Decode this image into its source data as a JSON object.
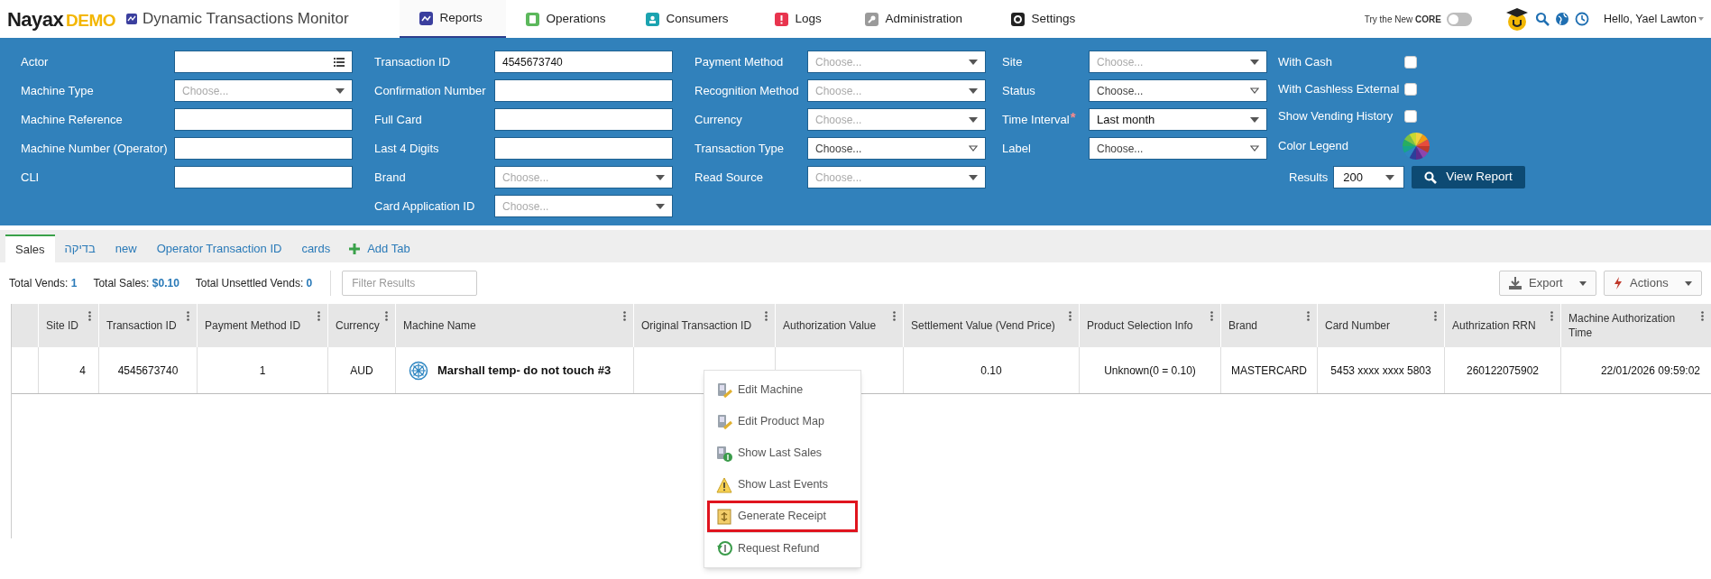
{
  "app": {
    "logo": "Nayax",
    "logo_badge": "DEMO",
    "title": "Dynamic Transactions Monitor"
  },
  "nav": [
    {
      "label": "Reports",
      "selected": true,
      "color": "#3b3f9e"
    },
    {
      "label": "Operations",
      "selected": false,
      "color": "#5cb85c"
    },
    {
      "label": "Consumers",
      "selected": false,
      "color": "#1ba3b0"
    },
    {
      "label": "Logs",
      "selected": false,
      "color": "#e8344e"
    },
    {
      "label": "Administration",
      "selected": false,
      "color": "#9a9a9a"
    },
    {
      "label": "Settings",
      "selected": false,
      "color": "#222222"
    }
  ],
  "header_right": {
    "try_label": "Try the New",
    "try_brand": "CORE",
    "toggle_on": false,
    "greeting": "Hello, Yael Lawton"
  },
  "filters": [
    [
      {
        "label": "Actor",
        "kind": "list"
      },
      {
        "label": "Machine Type",
        "kind": "select",
        "placeholder": "Choose..."
      },
      {
        "label": "Machine Reference",
        "kind": "text"
      },
      {
        "label": "Machine Number (Operator)",
        "kind": "text"
      },
      {
        "label": "CLI",
        "kind": "text"
      }
    ],
    [
      {
        "label": "Transaction ID",
        "kind": "text",
        "value": "4545673740"
      },
      {
        "label": "Confirmation Number",
        "kind": "text"
      },
      {
        "label": "Full Card",
        "kind": "text"
      },
      {
        "label": "Last 4 Digits",
        "kind": "text"
      },
      {
        "label": "Brand",
        "kind": "select",
        "placeholder": "Choose..."
      },
      {
        "label": "Card Application ID",
        "kind": "select",
        "placeholder": "Choose..."
      }
    ],
    [
      {
        "label": "Payment Method",
        "kind": "select",
        "placeholder": "Choose..."
      },
      {
        "label": "Recognition Method",
        "kind": "select",
        "placeholder": "Choose..."
      },
      {
        "label": "Currency",
        "kind": "select",
        "placeholder": "Choose..."
      },
      {
        "label": "Transaction Type",
        "kind": "multiselect",
        "placeholder": "Choose..."
      },
      {
        "label": "Read Source",
        "kind": "select",
        "placeholder": "Choose..."
      }
    ],
    [
      {
        "label": "Site",
        "kind": "select",
        "placeholder": "Choose..."
      },
      {
        "label": "Status",
        "kind": "multiselect",
        "placeholder": "Choose..."
      },
      {
        "label": "Time Interval",
        "kind": "select",
        "value": "Last month",
        "required": true
      },
      {
        "label": "Label",
        "kind": "multiselect",
        "placeholder": "Choose..."
      }
    ]
  ],
  "required_mark": "*",
  "checkboxes": [
    {
      "label": "With Cash",
      "checked": false
    },
    {
      "label": "With Cashless External",
      "checked": false
    },
    {
      "label": "Show Vending History",
      "checked": false
    }
  ],
  "color_legend": "Color Legend",
  "results": {
    "label": "Results",
    "value": "200"
  },
  "view_report": "View Report",
  "tabs": [
    {
      "label": "Sales",
      "selected": true
    },
    {
      "label": "בדיקה",
      "selected": false
    },
    {
      "label": "new",
      "selected": false
    },
    {
      "label": "Operator Transaction ID",
      "selected": false
    },
    {
      "label": "cards",
      "selected": false
    }
  ],
  "add_tab": "Add Tab",
  "summary": [
    {
      "label": "Total Vends:",
      "value": "1"
    },
    {
      "label": "Total Sales:",
      "value": "$0.10"
    },
    {
      "label": "Total Unsettled Vends:",
      "value": "0"
    }
  ],
  "filter_placeholder": "Filter Results",
  "export": "Export",
  "actions": "Actions",
  "table": {
    "columns": [
      "",
      "Site ID",
      "Transaction ID",
      "Payment Method ID",
      "Currency",
      "Machine Name",
      "Original Transaction ID",
      "Authorization Value",
      "Settlement Value (Vend Price)",
      "Product Selection Info",
      "Brand",
      "Card Number",
      "Authrization RRN",
      "Machine Authorization Time"
    ],
    "rows": [
      {
        "cells": [
          "",
          "4",
          "4545673740",
          "1",
          "AUD",
          "Marshall temp- do not touch #3",
          "",
          "",
          "0.10",
          "Unknown(0 = 0.10)",
          "MASTERCARD",
          "5453 xxxx xxxx 5803",
          "260122075902",
          "22/01/2026 09:59:02"
        ]
      }
    ]
  },
  "context_menu": [
    {
      "label": "Edit Machine",
      "kind": "edit-machine",
      "highlighted": false,
      "divider_before": false
    },
    {
      "label": "Edit Product Map",
      "kind": "edit-map",
      "highlighted": false,
      "divider_before": false
    },
    {
      "label": "Show Last Sales",
      "kind": "sales",
      "highlighted": false,
      "divider_before": false
    },
    {
      "label": "Show Last Events",
      "kind": "events",
      "highlighted": false,
      "divider_before": false
    },
    {
      "label": "Generate Receipt",
      "kind": "receipt",
      "highlighted": true,
      "divider_before": false
    },
    {
      "label": "Request Refund",
      "kind": "refund",
      "highlighted": false,
      "divider_before": true
    }
  ]
}
